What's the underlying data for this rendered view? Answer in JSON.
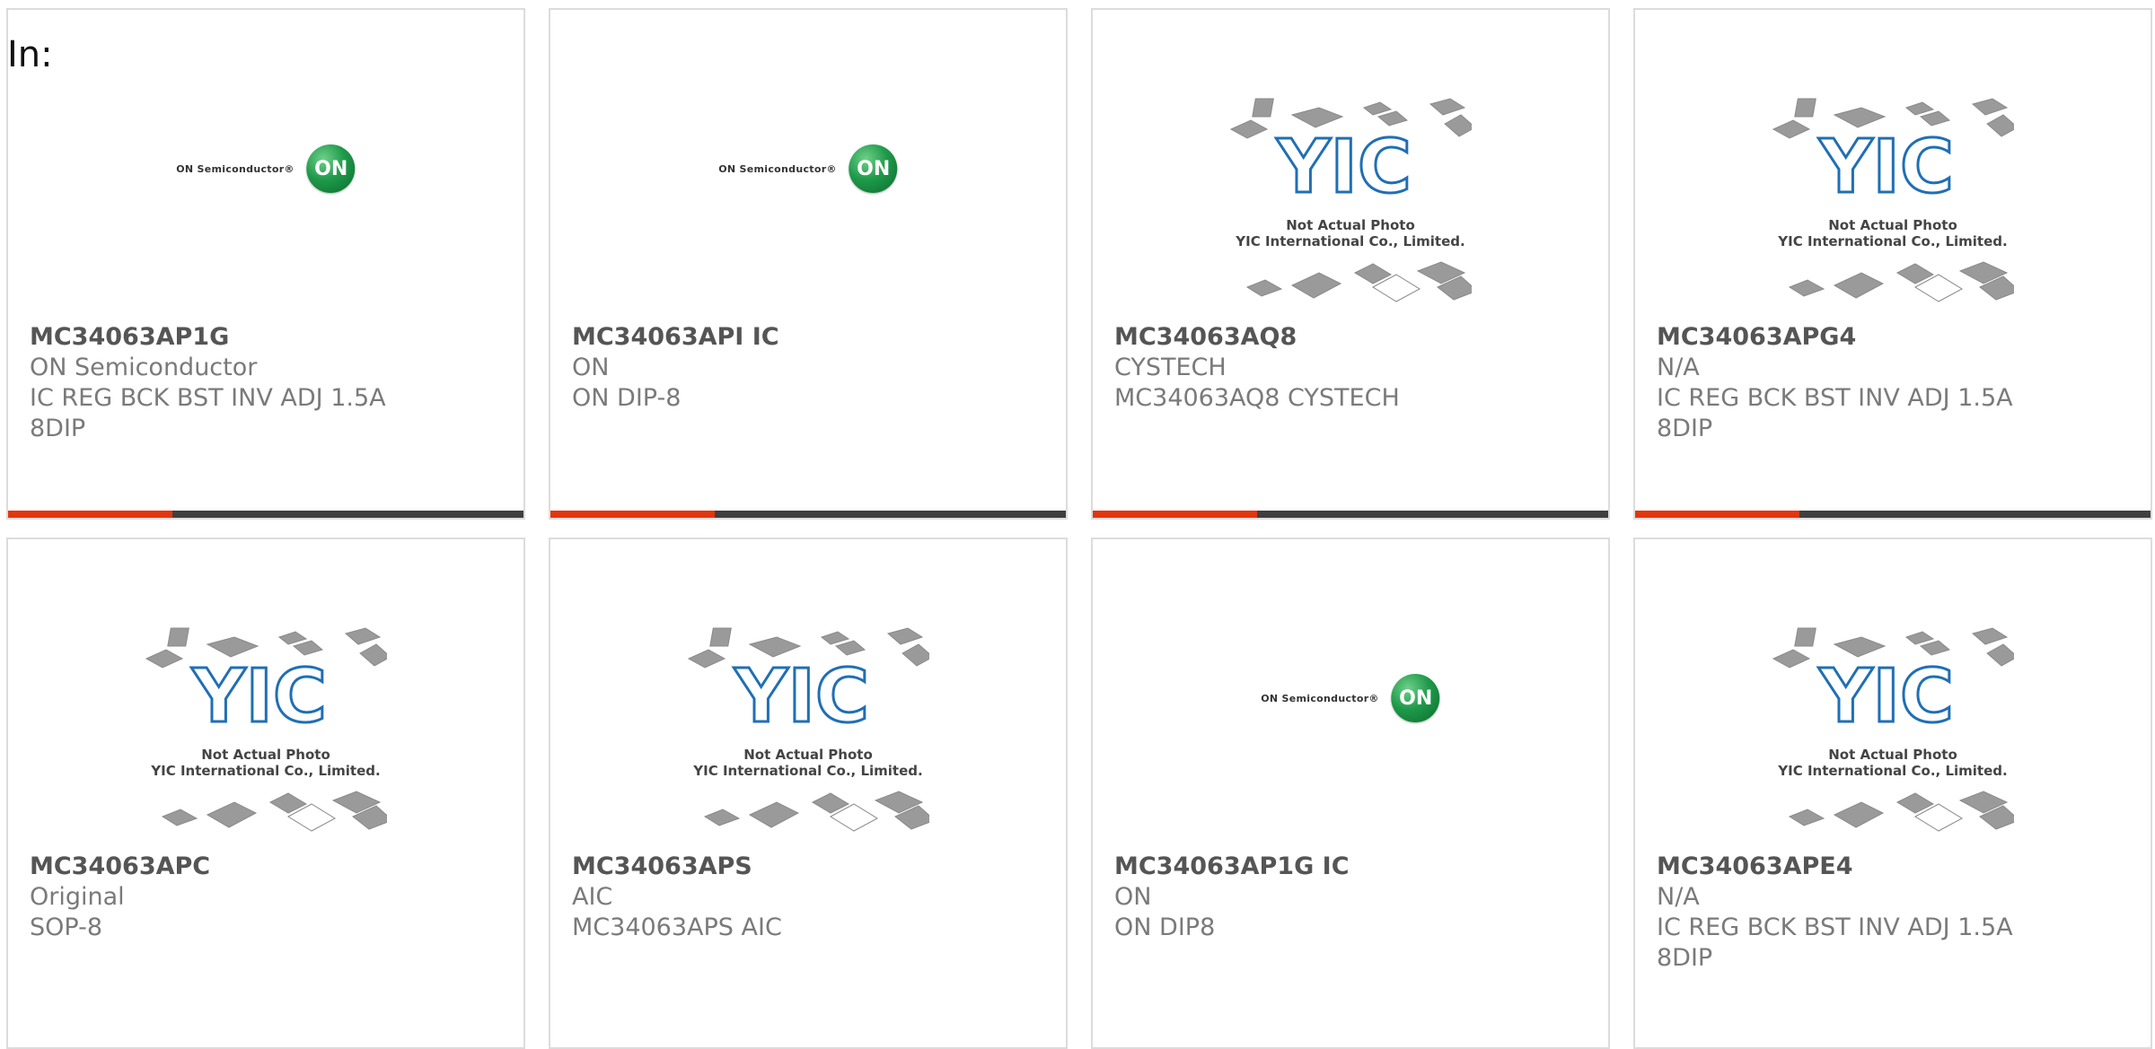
{
  "header": {
    "in_label": "In:"
  },
  "cards": [
    {
      "part": "MC34063AP1G",
      "lines": [
        "ON Semiconductor",
        "IC REG BCK BST INV ADJ 1.5A",
        "8DIP"
      ],
      "image": "on-logo",
      "logo_text": "ON Semiconductor®",
      "logo_mark": "ON"
    },
    {
      "part": "MC34063API IC",
      "lines": [
        "ON",
        "ON DIP-8"
      ],
      "image": "on-logo",
      "logo_text": "ON Semiconductor®",
      "logo_mark": "ON"
    },
    {
      "part": "MC34063AQ8",
      "lines": [
        "CYSTECH",
        "MC34063AQ8 CYSTECH"
      ],
      "image": "yic-placeholder",
      "caption1": "Not Actual Photo",
      "caption2": "YIC International Co., Limited."
    },
    {
      "part": "MC34063APG4",
      "lines": [
        "N/A",
        "IC REG BCK BST INV ADJ 1.5A",
        "8DIP"
      ],
      "image": "yic-placeholder",
      "caption1": "Not Actual Photo",
      "caption2": "YIC International Co., Limited."
    },
    {
      "part": "MC34063APC",
      "lines": [
        "Original",
        "SOP-8"
      ],
      "image": "yic-placeholder",
      "caption1": "Not Actual Photo",
      "caption2": "YIC International Co., Limited."
    },
    {
      "part": "MC34063APS",
      "lines": [
        "AIC",
        "MC34063APS AIC"
      ],
      "image": "yic-placeholder",
      "caption1": "Not Actual Photo",
      "caption2": "YIC International Co., Limited."
    },
    {
      "part": "MC34063AP1G IC",
      "lines": [
        "ON",
        "ON DIP8"
      ],
      "image": "on-logo",
      "logo_text": "ON Semiconductor®",
      "logo_mark": "ON"
    },
    {
      "part": "MC34063APE4",
      "lines": [
        "N/A",
        "IC REG BCK BST INV ADJ 1.5A",
        "8DIP"
      ],
      "image": "yic-placeholder",
      "caption1": "Not Actual Photo",
      "caption2": "YIC International Co., Limited."
    }
  ],
  "colors": {
    "accent": "#e2360e",
    "bar_dark": "#3f3f3f",
    "part_text": "#555555",
    "meta_text": "#7a7a7a"
  }
}
